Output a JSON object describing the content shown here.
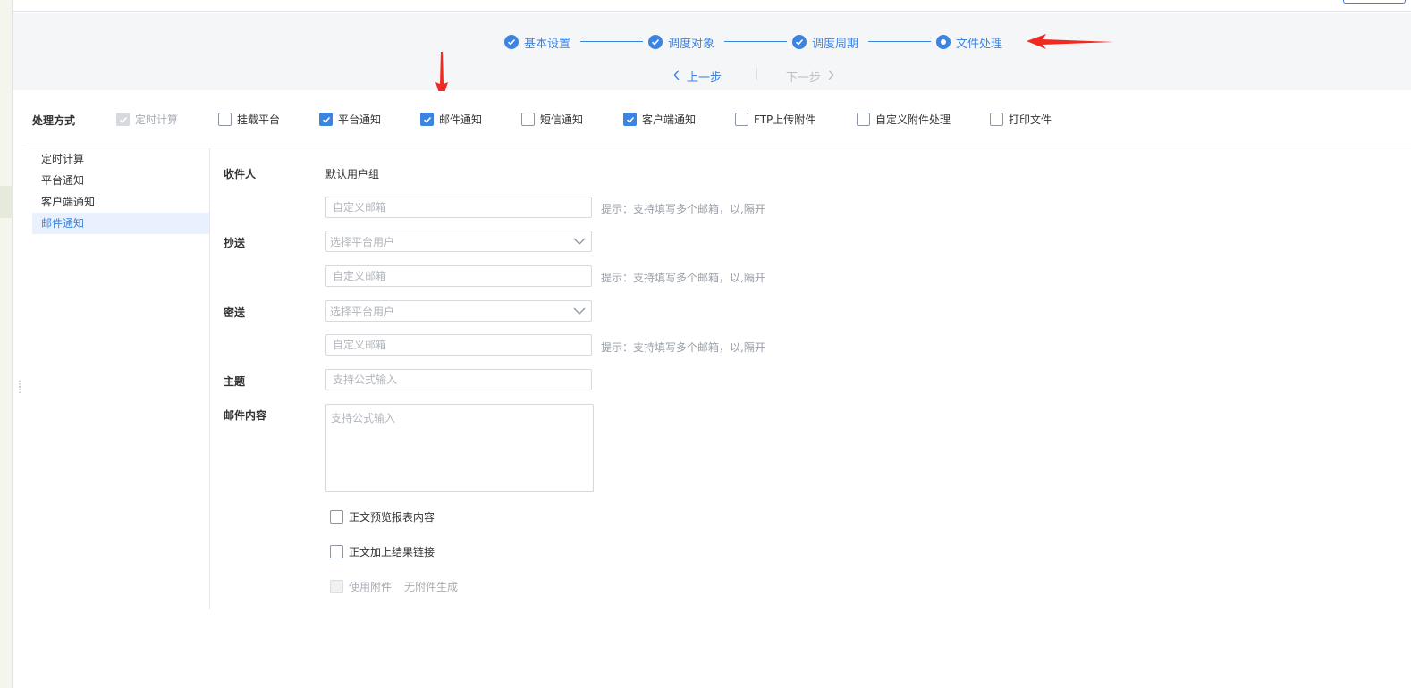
{
  "steps": [
    {
      "label": "基本设置",
      "state": "done"
    },
    {
      "label": "调度对象",
      "state": "done"
    },
    {
      "label": "调度周期",
      "state": "done"
    },
    {
      "label": "文件处理",
      "state": "current"
    }
  ],
  "pager": {
    "prev": "上一步",
    "next": "下一步"
  },
  "process": {
    "title": "处理方式",
    "options": [
      {
        "label": "定时计算",
        "checked": true,
        "disabled": true
      },
      {
        "label": "挂载平台",
        "checked": false,
        "disabled": false
      },
      {
        "label": "平台通知",
        "checked": true,
        "disabled": false
      },
      {
        "label": "邮件通知",
        "checked": true,
        "disabled": false
      },
      {
        "label": "短信通知",
        "checked": false,
        "disabled": false
      },
      {
        "label": "客户端通知",
        "checked": true,
        "disabled": false
      },
      {
        "label": "FTP上传附件",
        "checked": false,
        "disabled": false
      },
      {
        "label": "自定义附件处理",
        "checked": false,
        "disabled": false
      },
      {
        "label": "打印文件",
        "checked": false,
        "disabled": false
      }
    ]
  },
  "side_menu": {
    "items": [
      "定时计算",
      "平台通知",
      "客户端通知",
      "邮件通知"
    ],
    "active": "邮件通知"
  },
  "form": {
    "recipient_label": "收件人",
    "recipient_value": "默认用户组",
    "custom_email_placeholder": "自定义邮箱",
    "hint": "提示：支持填写多个邮箱，以,隔开",
    "cc_label": "抄送",
    "bcc_label": "密送",
    "select_placeholder": "选择平台用户",
    "subject_label": "主题",
    "formula_placeholder": "支持公式输入",
    "content_label": "邮件内容",
    "opt_preview": "正文预览报表内容",
    "opt_link": "正文加上结果链接",
    "opt_attach": "使用附件",
    "opt_attach_note": "无附件生成"
  },
  "colors": {
    "accent": "#3d83e0",
    "annotation": "#f02a22"
  }
}
